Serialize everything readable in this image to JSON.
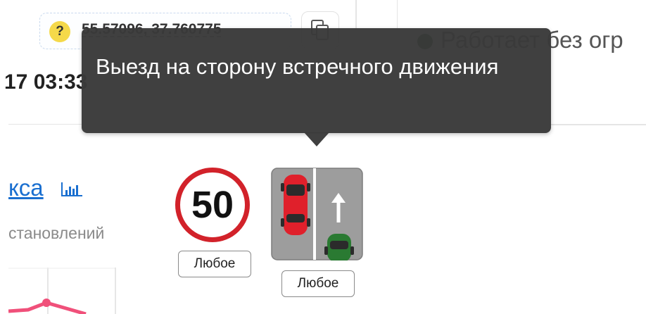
{
  "coordinates": {
    "badge": "?",
    "value": "55.57096, 37.760775",
    "copy_icon": "copy-icon"
  },
  "status": {
    "text": "Работает без огр",
    "dot_color": "#0f4d1b"
  },
  "timestamp": "17 03:33",
  "tooltip": {
    "text": "Выезд на сторону встречного движения"
  },
  "section": {
    "link_text": "кса",
    "chart_icon": "bar-chart-icon",
    "subtitle": "становлений"
  },
  "violations": [
    {
      "icon": "speed-limit-50-sign",
      "sign_value": "50",
      "tag_label": "Любое",
      "accent": "#d2222a"
    },
    {
      "icon": "oncoming-lane-sign",
      "tag_label": "Любое",
      "accent": "#e0202b"
    }
  ]
}
